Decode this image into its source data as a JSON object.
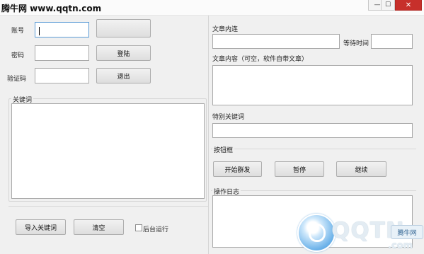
{
  "window": {
    "watermark": "腾牛网 www.qqtn.com",
    "minimize_glyph": "—",
    "maximize_glyph": "☐",
    "close_glyph": "✕"
  },
  "login": {
    "account_label": "账号",
    "account_value": "",
    "password_label": "密码",
    "password_value": "",
    "captcha_label": "验证码",
    "captcha_value": "",
    "login_button": "登陆",
    "exit_button": "退出"
  },
  "keywords": {
    "group_title": "关键词",
    "content": "",
    "import_button": "导入关键词",
    "clear_button": "清空",
    "background_run_label": "后台运行",
    "background_run_checked": false
  },
  "article": {
    "link_label": "文章内连",
    "link_value": "",
    "wait_label": "等待时间",
    "wait_value": "",
    "content_label": "文章内容（可空，软件自带文章）",
    "content_value": "",
    "special_label": "特别关键词",
    "special_value": ""
  },
  "controls": {
    "group_title": "按钮框",
    "start_button": "开始群发",
    "pause_button": "暂停",
    "resume_button": "继续"
  },
  "log": {
    "group_title": "操作日志",
    "content": ""
  },
  "logo": {
    "brand": "QQTN",
    "badge": "腾牛网",
    "domain": ".com"
  }
}
